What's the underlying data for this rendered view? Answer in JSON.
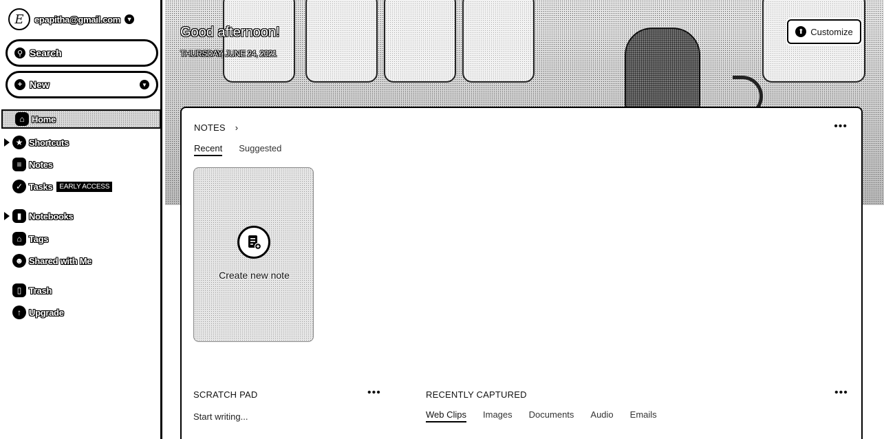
{
  "account": {
    "email": "epapitha@gmail.com",
    "avatar_letter": "E"
  },
  "sidebar": {
    "search_label": "Search",
    "new_label": "New",
    "items": [
      {
        "label": "Home",
        "icon": "home-icon",
        "active": true
      },
      {
        "label": "Shortcuts",
        "icon": "star-icon",
        "expandable": true
      },
      {
        "label": "Notes",
        "icon": "note-icon"
      },
      {
        "label": "Tasks",
        "icon": "check-circle-icon",
        "badge": "EARLY ACCESS"
      },
      {
        "label": "Notebooks",
        "icon": "notebook-icon",
        "expandable": true
      },
      {
        "label": "Tags",
        "icon": "tag-icon"
      },
      {
        "label": "Shared with Me",
        "icon": "people-icon"
      },
      {
        "label": "Trash",
        "icon": "trash-icon"
      },
      {
        "label": "Upgrade",
        "icon": "upgrade-icon"
      }
    ]
  },
  "hero": {
    "greeting": "Good afternoon!",
    "date": "THURSDAY, JUNE 24, 2021",
    "customize_label": "Customize"
  },
  "notes": {
    "title": "NOTES",
    "more": "•••",
    "tabs": [
      "Recent",
      "Suggested"
    ],
    "active_tab": "Recent",
    "create_label": "Create new note"
  },
  "scratch_pad": {
    "title": "SCRATCH PAD",
    "more": "•••",
    "placeholder": "Start writing..."
  },
  "recently_captured": {
    "title": "RECENTLY CAPTURED",
    "more": "•••",
    "tabs": [
      "Web Clips",
      "Images",
      "Documents",
      "Audio",
      "Emails"
    ],
    "active_tab": "Web Clips"
  }
}
